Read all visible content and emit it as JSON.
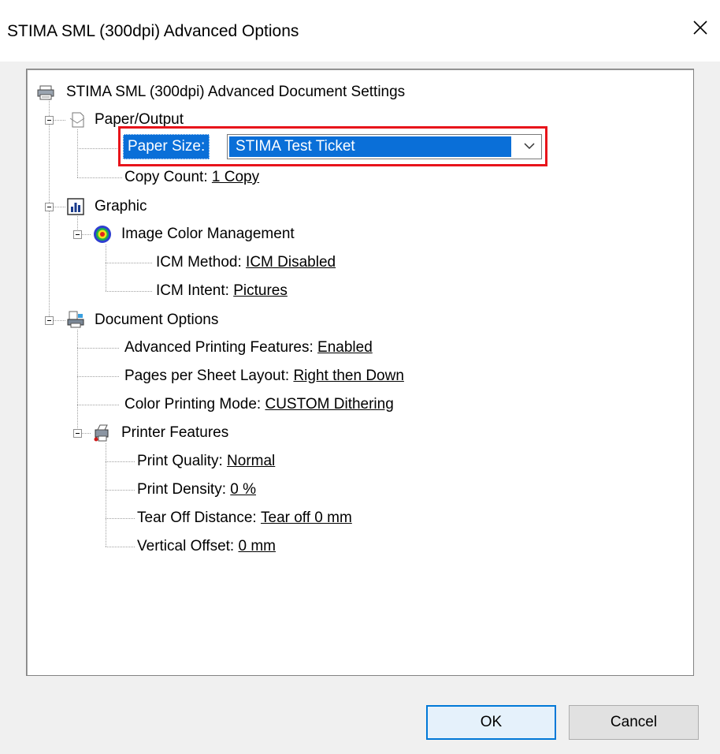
{
  "window": {
    "title": "STIMA SML (300dpi) Advanced Options"
  },
  "tree": {
    "root": "STIMA SML (300dpi) Advanced Document Settings",
    "paper_output": {
      "label": "Paper/Output",
      "paper_size_label": "Paper Size:",
      "paper_size_value": "STIMA Test Ticket",
      "copy_count_label": "Copy Count:",
      "copy_count_value": "1 Copy"
    },
    "graphic": {
      "label": "Graphic",
      "icm": {
        "label": "Image Color Management",
        "method_label": "ICM Method:",
        "method_value": "ICM Disabled",
        "intent_label": "ICM Intent:",
        "intent_value": "Pictures"
      }
    },
    "document_options": {
      "label": "Document Options",
      "advanced_label": "Advanced Printing Features:",
      "advanced_value": "Enabled",
      "pages_label": "Pages per Sheet Layout:",
      "pages_value": "Right then Down",
      "color_label": "Color Printing Mode:",
      "color_value": "CUSTOM Dithering",
      "printer_features": {
        "label": "Printer Features",
        "quality_label": "Print Quality:",
        "quality_value": "Normal",
        "density_label": "Print Density:",
        "density_value": "0 %",
        "tearoff_label": "Tear Off Distance:",
        "tearoff_value": "Tear off 0 mm",
        "offset_label": "Vertical Offset:",
        "offset_value": "0 mm"
      }
    }
  },
  "buttons": {
    "ok": "OK",
    "cancel": "Cancel"
  },
  "colors": {
    "selection": "#0a6fd8",
    "highlight_box": "#e8141b",
    "default_button_border": "#0078d7"
  },
  "icons": [
    "printer-icon",
    "paper-output-icon",
    "graphic-chart-icon",
    "color-wheel-icon",
    "document-options-icon",
    "printer-features-icon",
    "close-icon",
    "chevron-down-icon"
  ]
}
